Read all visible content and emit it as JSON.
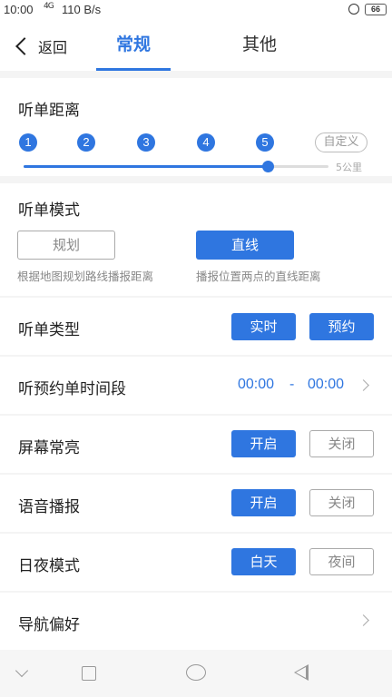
{
  "status_bar": {
    "time": "10:00",
    "signal": "4G",
    "speed": "110 B/s",
    "battery": "66"
  },
  "header": {
    "back_label": "返回",
    "tabs": [
      "常规",
      "其他"
    ],
    "active_tab": "常规"
  },
  "distance": {
    "title": "听单距离",
    "steps": [
      "1",
      "2",
      "3",
      "4",
      "5"
    ],
    "custom_label": "自定义",
    "slider_value_label": "5公里",
    "slider_fraction": 0.8
  },
  "mode": {
    "title": "听单模式",
    "options": [
      {
        "label": "规划",
        "hint": "根据地图规划路线播报距离",
        "selected": false
      },
      {
        "label": "直线",
        "hint": "播报位置两点的直线距离",
        "selected": true
      }
    ]
  },
  "order_type": {
    "title": "听单类型",
    "options": [
      "实时",
      "预约"
    ]
  },
  "reserve_time": {
    "title": "听预约单时间段",
    "start": "00:00",
    "separator": "-",
    "end": "00:00"
  },
  "screen": {
    "title": "屏幕常亮",
    "on": "开启",
    "off": "关闭"
  },
  "voice": {
    "title": "语音播报",
    "on": "开启",
    "off": "关闭"
  },
  "daynight": {
    "title": "日夜模式",
    "day": "白天",
    "night": "夜间"
  },
  "navigation": {
    "title": "导航偏好"
  },
  "colors": {
    "accent": "#2f76e0",
    "background": "#f4f4f4"
  },
  "icons": [
    "chevron-left-icon",
    "chevron-right-icon",
    "nav-back-icon",
    "nav-recent-icon",
    "nav-home-icon",
    "nav-triangle-back-icon"
  ]
}
